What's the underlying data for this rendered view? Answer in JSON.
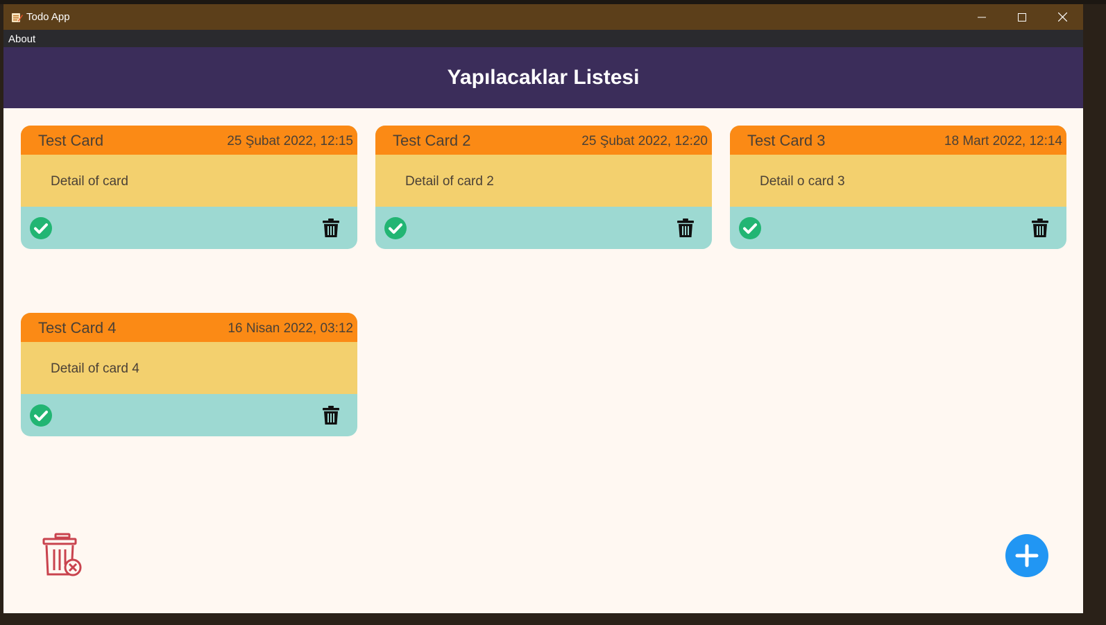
{
  "window": {
    "title": "Todo App",
    "controls": {
      "minimize": "minimize-icon",
      "maximize": "maximize-icon",
      "close": "close-icon"
    }
  },
  "menu": {
    "items": [
      {
        "label": "About"
      }
    ]
  },
  "header": {
    "title": "Yapılacaklar Listesi"
  },
  "cards": [
    {
      "title": "Test Card",
      "date": "25 Şubat 2022, 12:15",
      "detail": "Detail of card"
    },
    {
      "title": "Test Card 2",
      "date": "25 Şubat 2022, 12:20",
      "detail": "Detail of card 2"
    },
    {
      "title": "Test Card 3",
      "date": "18 Mart 2022, 12:14",
      "detail": "Detail o card 3"
    },
    {
      "title": "Test Card 4",
      "date": "16 Nisan 2022, 03:12",
      "detail": "Detail of card 4"
    }
  ],
  "actions": {
    "clear_all_icon": "trash-x-icon",
    "add_icon": "plus-icon"
  },
  "colors": {
    "titlebar": "#5c3f1a",
    "header": "#3b2d5a",
    "card_header": "#fb8a15",
    "card_body": "#f3d06e",
    "card_footer": "#9dd9d2",
    "done": "#22b573",
    "add_button": "#2196f3",
    "clear_all": "#c9434e",
    "background": "#fff8f2"
  }
}
